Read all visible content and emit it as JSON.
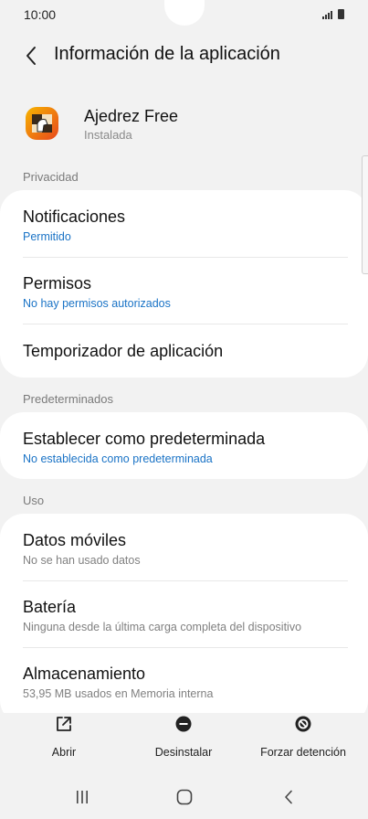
{
  "status_bar": {
    "time": "10:00"
  },
  "header": {
    "title": "Información de la aplicación"
  },
  "app": {
    "name": "Ajedrez Free",
    "status": "Instalada"
  },
  "sections": {
    "privacy": "Privacidad",
    "defaults": "Predeterminados",
    "usage": "Uso"
  },
  "privacy_items": {
    "notifications": {
      "title": "Notificaciones",
      "sub": "Permitido"
    },
    "permissions": {
      "title": "Permisos",
      "sub": "No hay permisos autorizados"
    },
    "timer": {
      "title": "Temporizador de aplicación"
    }
  },
  "default_items": {
    "set_default": {
      "title": "Establecer como predeterminada",
      "sub": "No establecida como predeterminada"
    }
  },
  "usage_items": {
    "mobile_data": {
      "title": "Datos móviles",
      "sub": "No se han usado datos"
    },
    "battery": {
      "title": "Batería",
      "sub": "Ninguna desde la última carga completa del dispositivo"
    },
    "storage": {
      "title": "Almacenamiento",
      "sub": "53,95 MB usados en Memoria interna"
    }
  },
  "actions": {
    "open": "Abrir",
    "uninstall": "Desinstalar",
    "force_stop": "Forzar detención"
  },
  "colors": {
    "accent": "#1a73c6",
    "background": "#f2f2f2",
    "card": "#ffffff"
  },
  "icons": {
    "back": "chevron-left-icon",
    "open": "open-external-icon",
    "uninstall": "minus-circle-icon",
    "force_stop": "stop-circle-icon",
    "nav_recents": "recents-icon",
    "nav_home": "home-icon",
    "nav_back": "back-icon"
  }
}
